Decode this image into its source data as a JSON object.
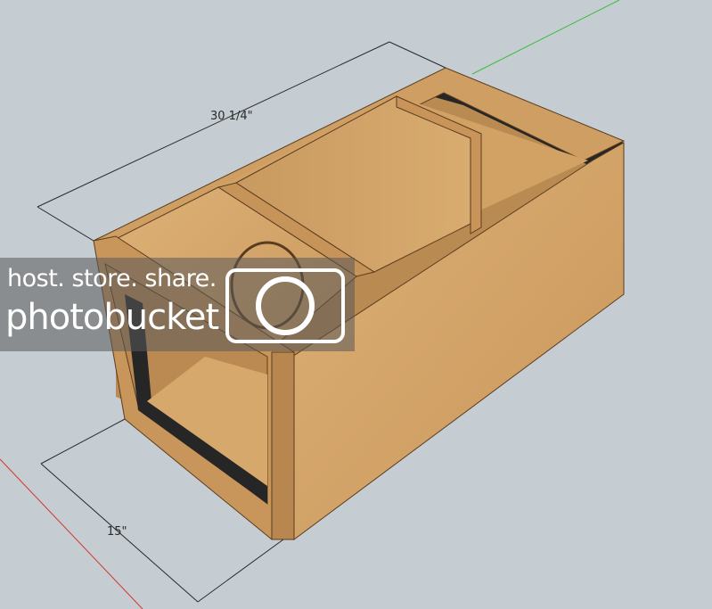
{
  "dimensions": {
    "length_label": "30 1/4\"",
    "depth_label": "15\""
  },
  "watermark": {
    "line1": "host. store. share.",
    "line2": "photobucket"
  },
  "colors": {
    "background": "#c5ccd2",
    "wood_light": "#d7a86a",
    "wood_mid": "#c9965a",
    "wood_dark": "#a8753e",
    "gasket": "#262626",
    "red_axis": "#d23a2a",
    "green_axis": "#3cbf3c"
  }
}
